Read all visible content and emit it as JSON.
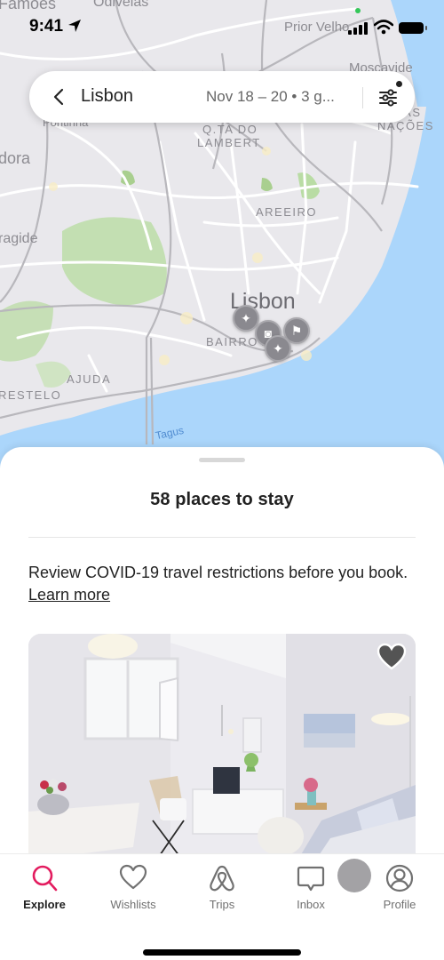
{
  "status_bar": {
    "time": "9:41",
    "location_icon": "location-arrow-icon",
    "signal_icon": "cellular-signal-icon",
    "wifi_icon": "wifi-icon",
    "battery_icon": "battery-icon"
  },
  "search": {
    "back_icon": "chevron-left-icon",
    "location": "Lisbon",
    "details": "Nov 18 – 20 • 3 g...",
    "filter_icon": "sliders-icon",
    "filter_active": true
  },
  "map": {
    "labels": {
      "odivelas": "Odivelas",
      "famoes": "Famões",
      "prior_velho": "Prior Velho",
      "moscavide": "Moscavide",
      "pontinha": "Pontinha",
      "qta_do_lambert_1": "Q.TA DO",
      "qta_do_lambert_2": "LAMBERT",
      "dora": "dora",
      "areeiro": "AREEIRO",
      "ragide": "ragide",
      "parque_das_nacoes_1": "E DAS",
      "parque_das_nacoes_2": "NAÇÕES",
      "lisbon": "Lisbon",
      "bairro_alto": "BAIRRO A",
      "ajuda": "AJUDA",
      "restelo": "RESTELO",
      "tagus": "Tagus"
    },
    "pins": [
      {
        "icon": "sparkle-icon",
        "glyph": "✦"
      },
      {
        "icon": "camera-icon",
        "glyph": "◙"
      },
      {
        "icon": "signpost-icon",
        "glyph": "⚑"
      },
      {
        "icon": "sparkle-icon",
        "glyph": "✦"
      }
    ],
    "colors": {
      "land": "#e9e8ec",
      "water": "#abd6fb",
      "park": "#b9dca4",
      "road": "#ffffff"
    }
  },
  "sheet": {
    "title": "58 places to stay",
    "notice_text": "Review COVID-19 travel restrictions before you book. ",
    "notice_link": "Learn more",
    "listing": {
      "photo_alt": "Bright white living room with rattan chair, TV cabinet and sofa",
      "wishlist_icon": "heart-icon",
      "saved": false
    }
  },
  "tab_bar": {
    "accent": "#e31c5f",
    "tabs": [
      {
        "label": "Explore",
        "icon": "search-icon",
        "active": true
      },
      {
        "label": "Wishlists",
        "icon": "heart-outline-icon",
        "active": false
      },
      {
        "label": "Trips",
        "icon": "airbnb-logo-icon",
        "active": false
      },
      {
        "label": "Inbox",
        "icon": "message-icon",
        "active": false
      },
      {
        "label": "Profile",
        "icon": "profile-icon",
        "active": false
      }
    ]
  }
}
